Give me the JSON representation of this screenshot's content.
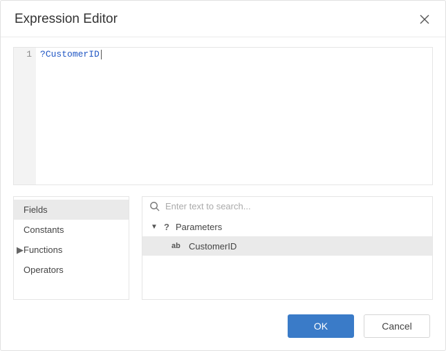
{
  "dialog": {
    "title": "Expression Editor"
  },
  "editor": {
    "line_number": "1",
    "expression_prefix": "?",
    "expression_token": "CustomerID"
  },
  "categories": {
    "items": [
      {
        "label": "Fields",
        "selected": true
      },
      {
        "label": "Constants",
        "selected": false
      },
      {
        "label": "Functions",
        "selected": false,
        "expandable": true
      },
      {
        "label": "Operators",
        "selected": false
      }
    ]
  },
  "search": {
    "placeholder": "Enter text to search..."
  },
  "tree": {
    "group_label": "Parameters",
    "child_label": "CustomerID"
  },
  "buttons": {
    "ok": "OK",
    "cancel": "Cancel"
  }
}
